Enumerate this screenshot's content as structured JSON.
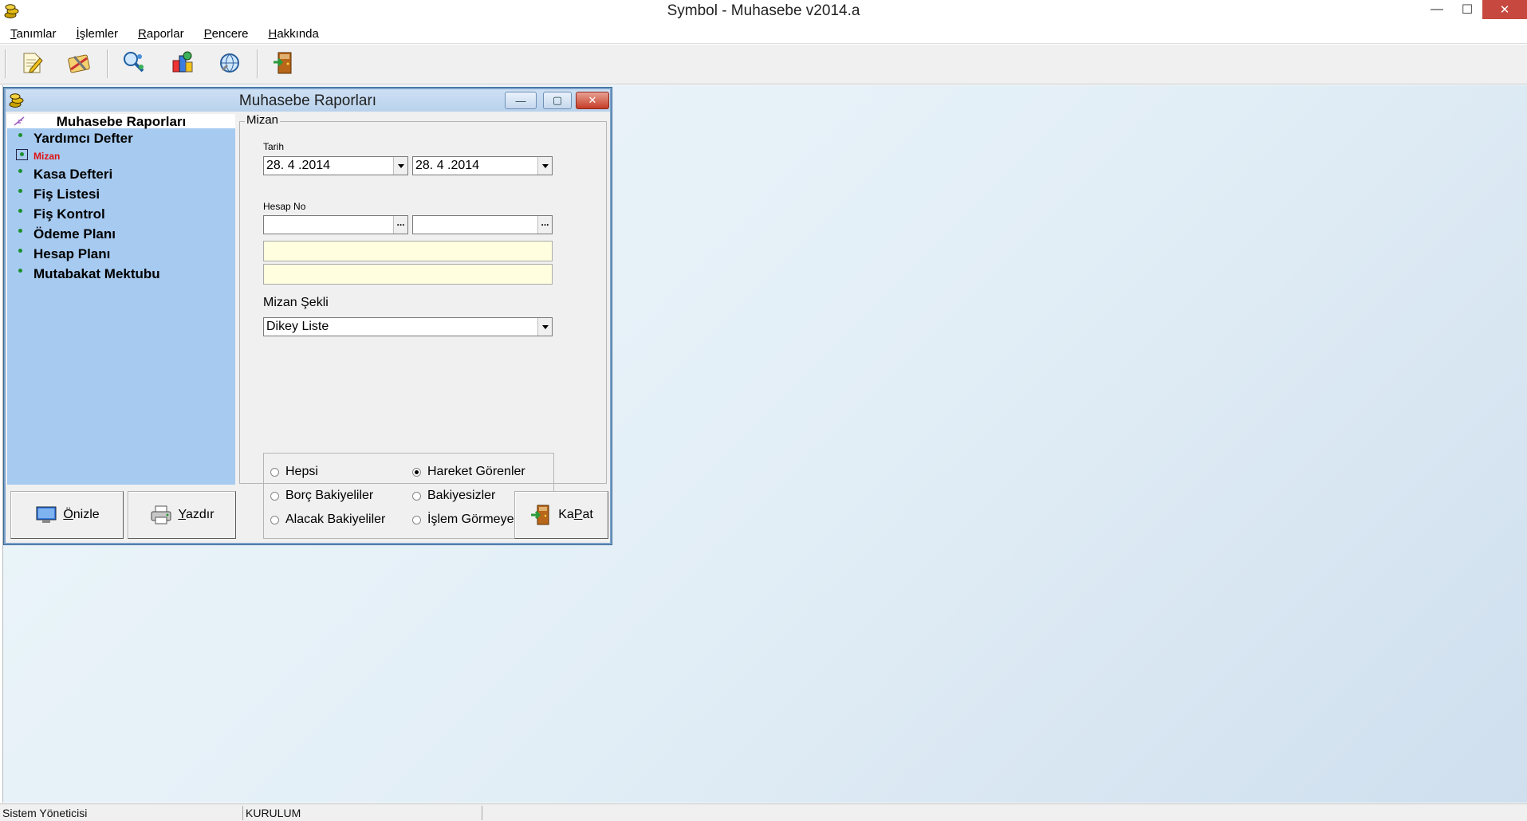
{
  "app": {
    "title": "Symbol - Muhasebe v2014.a",
    "window_controls": {
      "minimize": "—",
      "maximize": "☐",
      "close": "✕"
    }
  },
  "menu": {
    "items": [
      {
        "first": "T",
        "rest": "anımlar"
      },
      {
        "first": "İ",
        "rest": "şlemler"
      },
      {
        "first": "R",
        "rest": "aporlar"
      },
      {
        "first": "P",
        "rest": "encere"
      },
      {
        "first": "H",
        "rest": "akkında"
      }
    ]
  },
  "toolbar": {
    "icons": [
      "edit-document-icon",
      "tools-icon",
      "search-people-icon",
      "chart-icon",
      "globe-icon",
      "exit-door-icon"
    ]
  },
  "child_window": {
    "title": "Muhasebe Raporları",
    "controls": {
      "minimize": "—",
      "maximize": "▢",
      "close": "✕"
    }
  },
  "nav": {
    "header": "Muhasebe Raporları",
    "items": [
      {
        "label": "Yardımcı Defter",
        "active": false
      },
      {
        "label": "Mizan",
        "active": true
      },
      {
        "label": "Kasa Defteri",
        "active": false
      },
      {
        "label": "Fiş Listesi",
        "active": false
      },
      {
        "label": "Fiş Kontrol",
        "active": false
      },
      {
        "label": "Ödeme Planı",
        "active": false
      },
      {
        "label": "Hesap Planı",
        "active": false
      },
      {
        "label": "Mutabakat Mektubu",
        "active": false
      }
    ]
  },
  "form": {
    "group_title": "Mizan",
    "tarih_label": "Tarih",
    "date_from": "28. 4 .2014",
    "date_to": "28. 4 .2014",
    "hesap_label": "Hesap No",
    "hesap_from": "",
    "hesap_to": "",
    "lookup_button": "...",
    "desc1": "",
    "desc2": "",
    "mizan_sekli_label": "Mizan Şekli",
    "mizan_sekli_value": "Dikey Liste",
    "radios": {
      "hepsi": "Hepsi",
      "borc": "Borç Bakiyeliler",
      "alacak": "Alacak Bakiyeliler",
      "hareket": "Hareket Görenler",
      "bakiyesiz": "Bakiyesizler",
      "islem": "İşlem Görmeyenler",
      "selected": "hareket"
    }
  },
  "buttons": {
    "onizle": {
      "first": "Ö",
      "rest": "nizle"
    },
    "yazdir": {
      "first": "Y",
      "rest": "azdır"
    },
    "kapat": {
      "pre": "Ka",
      "mid": "P",
      "post": "at"
    }
  },
  "status": {
    "user": "Sistem Yöneticisi",
    "company": "KURULUM",
    "extra": ""
  }
}
